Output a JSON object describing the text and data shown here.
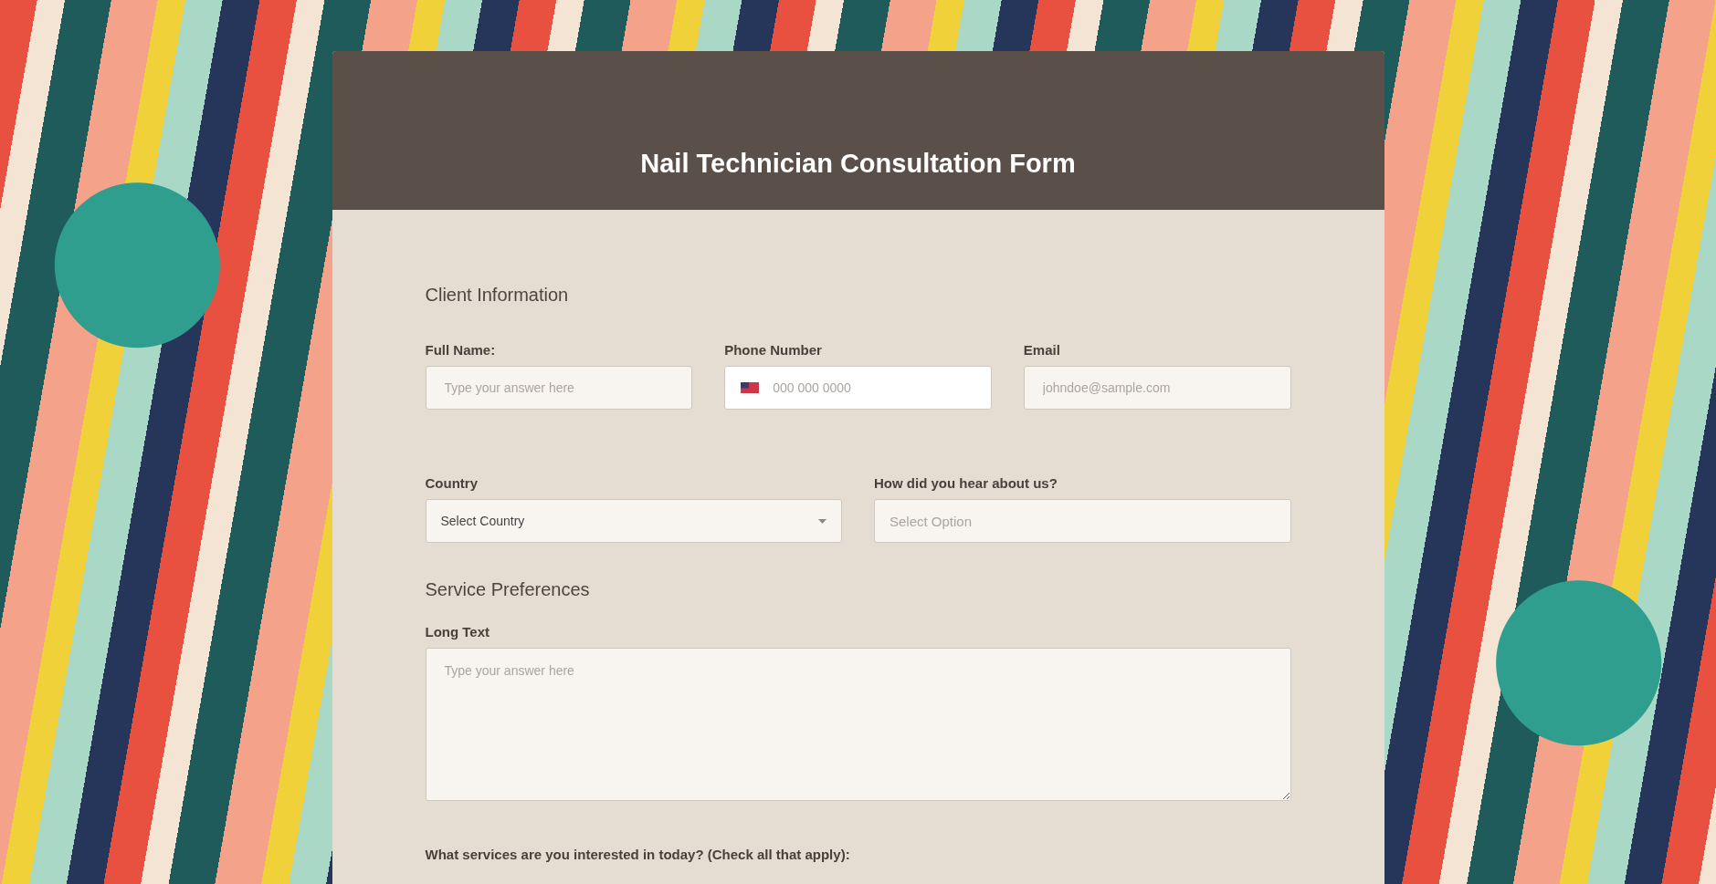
{
  "form": {
    "title": "Nail Technician Consultation Form",
    "sections": [
      {
        "heading": "Client Information",
        "rows": [
          {
            "fields": [
              {
                "kind": "text",
                "label": "Full Name:",
                "placeholder": "Type your answer here"
              },
              {
                "kind": "phone",
                "label": "Phone Number",
                "placeholder": "000 000 0000"
              },
              {
                "kind": "text",
                "label": "Email",
                "placeholder": "johndoe@sample.com"
              }
            ]
          },
          {
            "fields": [
              {
                "kind": "select",
                "label": "Country",
                "value": "Select Country",
                "caret": true
              },
              {
                "kind": "select",
                "label": "How did you hear about us?",
                "placeholder": "Select Option",
                "caret": false
              }
            ]
          }
        ]
      },
      {
        "heading": "Service Preferences",
        "rows": [
          {
            "fields": [
              {
                "kind": "textarea",
                "label": "Long Text",
                "placeholder": "Type your answer here"
              }
            ]
          },
          {
            "fields": [
              {
                "kind": "question",
                "label": "What services are you interested in today? (Check all that apply):"
              }
            ]
          }
        ]
      }
    ]
  }
}
